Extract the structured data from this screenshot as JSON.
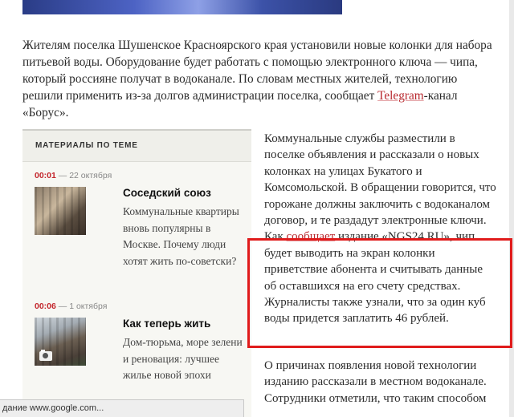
{
  "article": {
    "lead": [
      "Жителям поселка Шушенское Красноярского края установили новые колонки для набора питьевой воды. Оборудование будет работать с помощью электронного ключа — чипа, который россияне получат в водоканале. По словам местных жителей, технологию решили применить из-за долгов администрации поселка, сообщает ",
      "Telegram",
      "-канал «Борус»."
    ],
    "paragraph_1": [
      "Коммунальные службы разместили в поселке объявления и рассказали о новых колонках на улицах Букатого и Комсомольской. В обращении говорится, что горожане должны заключить с водоканалом договор, и те раздадут электронные ключи. Как ",
      "сообщает",
      " издание «NGS24.RU», чип будет выводить на экран колонки приветствие абонента и считывать данные об оставшихся на его счету средствах. Журналисты также узнали, что за один куб воды придется заплатить 46 рублей."
    ],
    "paragraph_2": "О причинах появления новой технологии изданию рассказали в местном водоканале. Сотрудники отметили, что таким способом"
  },
  "sidebar": {
    "heading": "МАТЕРИАЛЫ ПО ТЕМЕ",
    "items": [
      {
        "time": "00:01",
        "date": " — 22 октября",
        "title": "Соседский союз",
        "description": "Коммунальные квартиры вновь популярны в Москве. Почему люди хотят жить по-советски?",
        "thumbnail_icon": "photo-thumbnail"
      },
      {
        "time": "00:06",
        "date": " — 1 октября",
        "title": "Как теперь жить",
        "description": "Дом-тюрьма, море зелени и реновация: лучшее жилье новой эпохи",
        "thumbnail_icon": "camera-icon"
      }
    ]
  },
  "status_bar": {
    "text": "дание www.google.com..."
  },
  "colors": {
    "accent_red": "#b8282e",
    "highlight_box": "#e01b1b"
  }
}
